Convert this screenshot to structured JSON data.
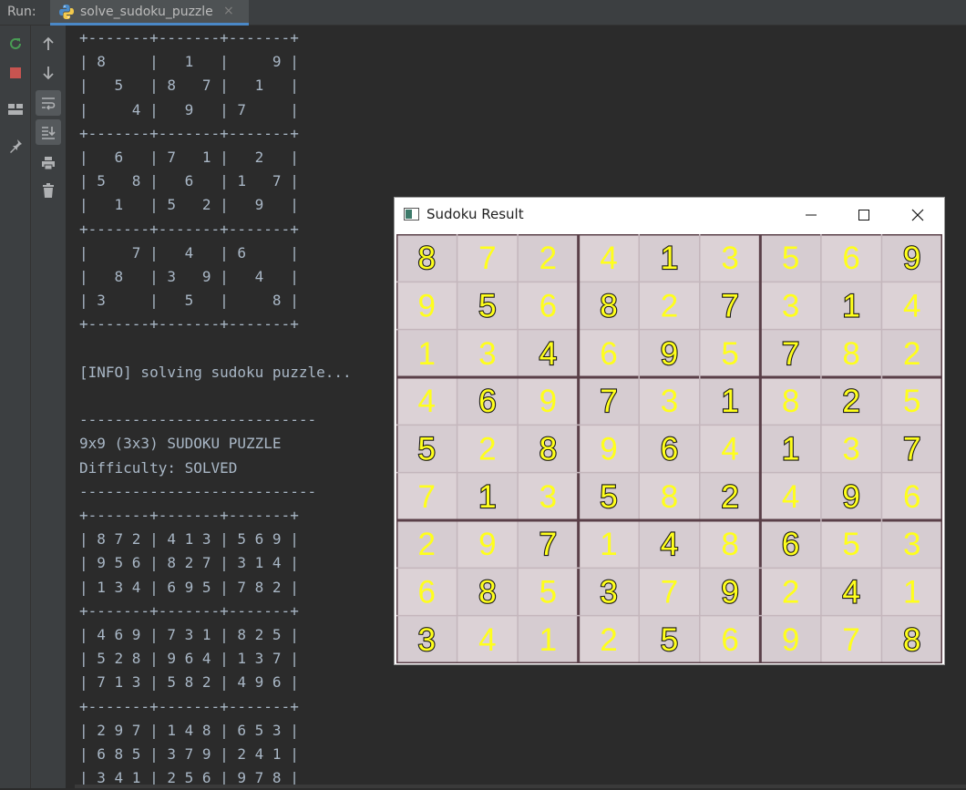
{
  "run_bar": {
    "label": "Run:",
    "tab_title": "solve_sudoku_puzzle",
    "close_glyph": "×"
  },
  "toolbar": {
    "col1": [
      {
        "name": "rerun-icon",
        "color": "#499c54"
      },
      {
        "name": "stop-icon",
        "color": "#c75450"
      },
      {
        "name": "layout-icon",
        "color": "#afb1b3"
      },
      {
        "name": "pin-icon",
        "color": "#afb1b3"
      }
    ],
    "col2": [
      {
        "name": "scroll-up-icon"
      },
      {
        "name": "scroll-down-icon"
      },
      {
        "name": "soft-wrap-icon",
        "active": true
      },
      {
        "name": "scroll-to-end-icon",
        "active": true
      },
      {
        "name": "print-icon"
      },
      {
        "name": "clear-all-icon"
      }
    ]
  },
  "console": {
    "lines": [
      "+-------+-------+-------+",
      "| 8     |   1   |     9 |",
      "|   5   | 8   7 |   1   |",
      "|     4 |   9   | 7     |",
      "+-------+-------+-------+",
      "|   6   | 7   1 |   2   |",
      "| 5   8 |   6   | 1   7 |",
      "|   1   | 5   2 |   9   |",
      "+-------+-------+-------+",
      "|     7 |   4   | 6     |",
      "|   8   | 3   9 |   4   |",
      "| 3     |   5   |     8 |",
      "+-------+-------+-------+",
      "",
      "[INFO] solving sudoku puzzle...",
      "",
      "---------------------------",
      "9x9 (3x3) SUDOKU PUZZLE",
      "Difficulty: SOLVED",
      "---------------------------",
      "+-------+-------+-------+",
      "| 8 7 2 | 4 1 3 | 5 6 9 |",
      "| 9 5 6 | 8 2 7 | 3 1 4 |",
      "| 1 3 4 | 6 9 5 | 7 8 2 |",
      "+-------+-------+-------+",
      "| 4 6 9 | 7 3 1 | 8 2 5 |",
      "| 5 2 8 | 9 6 4 | 1 3 7 |",
      "| 7 1 3 | 5 8 2 | 4 9 6 |",
      "+-------+-------+-------+",
      "| 2 9 7 | 1 4 8 | 6 5 3 |",
      "| 6 8 5 | 3 7 9 | 2 4 1 |",
      "| 3 4 1 | 2 5 6 | 9 7 8 |"
    ]
  },
  "result_window": {
    "title": "Sudoku Result",
    "buttons": [
      "minimize-button",
      "maximize-button",
      "close-button"
    ],
    "digit_color": "#ffff1c",
    "grid": [
      [
        8,
        7,
        2,
        4,
        1,
        3,
        5,
        6,
        9
      ],
      [
        9,
        5,
        6,
        8,
        2,
        7,
        3,
        1,
        4
      ],
      [
        1,
        3,
        4,
        6,
        9,
        5,
        7,
        8,
        2
      ],
      [
        4,
        6,
        9,
        7,
        3,
        1,
        8,
        2,
        5
      ],
      [
        5,
        2,
        8,
        9,
        6,
        4,
        1,
        3,
        7
      ],
      [
        7,
        1,
        3,
        5,
        8,
        2,
        4,
        9,
        6
      ],
      [
        2,
        9,
        7,
        1,
        4,
        8,
        6,
        5,
        3
      ],
      [
        6,
        8,
        5,
        3,
        7,
        9,
        2,
        4,
        1
      ],
      [
        3,
        4,
        1,
        2,
        5,
        6,
        9,
        7,
        8
      ]
    ],
    "given": [
      [
        1,
        0,
        0,
        0,
        1,
        0,
        0,
        0,
        1
      ],
      [
        0,
        1,
        0,
        1,
        0,
        1,
        0,
        1,
        0
      ],
      [
        0,
        0,
        1,
        0,
        1,
        0,
        1,
        0,
        0
      ],
      [
        0,
        1,
        0,
        1,
        0,
        1,
        0,
        1,
        0
      ],
      [
        1,
        0,
        1,
        0,
        1,
        0,
        1,
        0,
        1
      ],
      [
        0,
        1,
        0,
        1,
        0,
        1,
        0,
        1,
        0
      ],
      [
        0,
        0,
        1,
        0,
        1,
        0,
        1,
        0,
        0
      ],
      [
        0,
        1,
        0,
        1,
        0,
        1,
        0,
        1,
        0
      ],
      [
        1,
        0,
        0,
        0,
        1,
        0,
        0,
        0,
        1
      ]
    ]
  }
}
